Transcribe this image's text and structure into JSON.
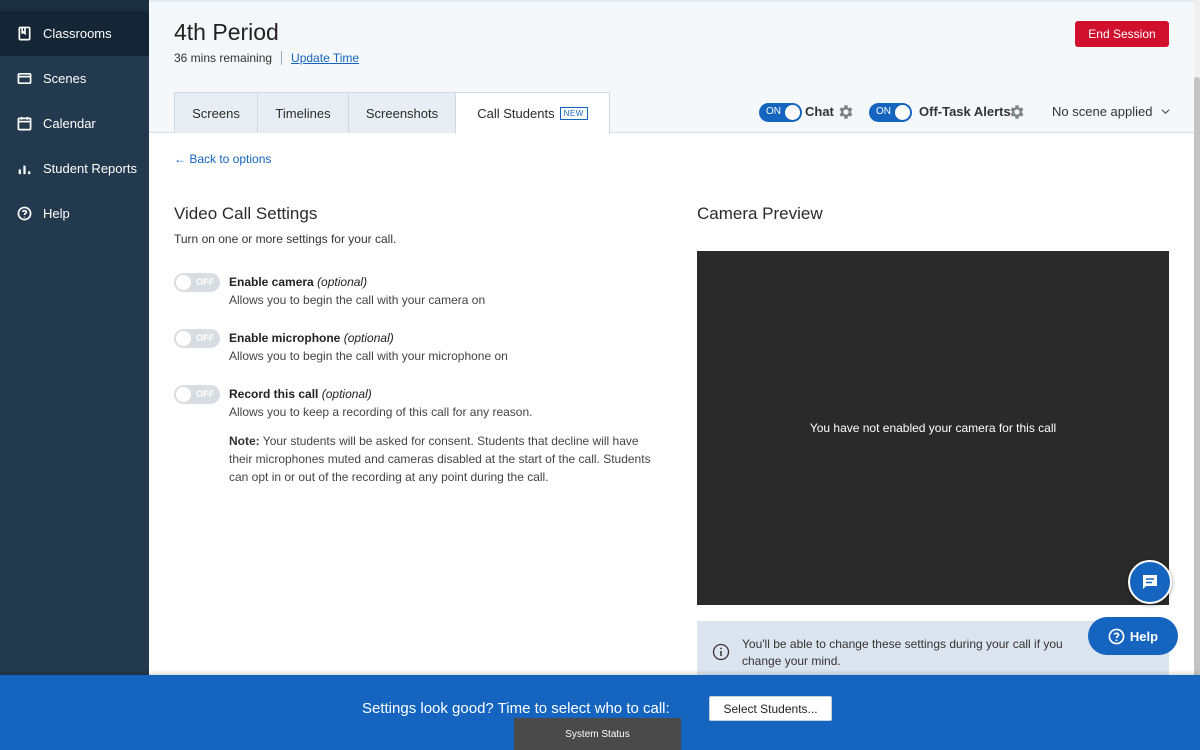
{
  "sidebar": {
    "items": [
      {
        "label": "Classrooms",
        "icon": "book-icon"
      },
      {
        "label": "Scenes",
        "icon": "scenes-icon"
      },
      {
        "label": "Calendar",
        "icon": "calendar-icon"
      },
      {
        "label": "Student Reports",
        "icon": "bar-chart-icon"
      },
      {
        "label": "Help",
        "icon": "help-circle-icon"
      }
    ]
  },
  "header": {
    "title": "4th Period",
    "remaining": "36 mins remaining",
    "update_time": "Update Time",
    "end_session": "End Session",
    "tabs": [
      {
        "label": "Screens"
      },
      {
        "label": "Timelines"
      },
      {
        "label": "Screenshots"
      },
      {
        "label": "Call Students",
        "badge": "NEW"
      }
    ],
    "chat": {
      "state": "ON",
      "label": "Chat"
    },
    "off_task": {
      "state": "ON",
      "label": "Off-Task Alerts"
    },
    "scene": "No scene applied"
  },
  "content": {
    "back_link": "← Back to options",
    "settings_title": "Video Call Settings",
    "settings_desc": "Turn on one or more settings for your call.",
    "options": [
      {
        "toggle": "OFF",
        "title": "Enable camera",
        "optional": "(optional)",
        "desc": "Allows you to begin the call with your camera on"
      },
      {
        "toggle": "OFF",
        "title": "Enable microphone",
        "optional": "(optional)",
        "desc": "Allows you to begin the call with your microphone on"
      },
      {
        "toggle": "OFF",
        "title": "Record this call",
        "optional": "(optional)",
        "desc": "Allows you to keep a recording of this call for any reason."
      }
    ],
    "note_label": "Note:",
    "note_text": "Your students will be asked for consent. Students that decline will have their microphones muted and cameras disabled at the start of the call. Students can opt in or out of the recording at any point during the call.",
    "preview_title": "Camera Preview",
    "preview_message": "You have not enabled your camera for this call",
    "info_text": "You'll be able to change these settings during your call if you change your mind."
  },
  "help_button": "Help",
  "bottom": {
    "prompt": "Settings look good? Time to select who to call:",
    "select_button": "Select Students...",
    "system_status": "System Status"
  },
  "colors": {
    "sidebar": "#23394d",
    "accent": "#1565c0",
    "danger": "#d0102c",
    "preview_bg": "#2a2a2a"
  }
}
